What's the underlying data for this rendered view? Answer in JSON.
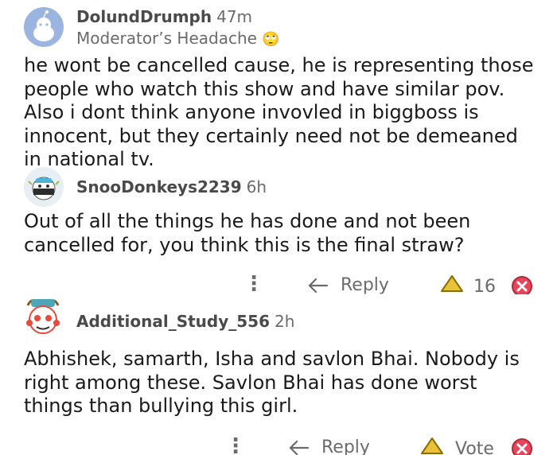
{
  "comments": [
    {
      "username": "DolundDrumph",
      "time": "47m",
      "flair": "Moderator’s Headache",
      "flair_emoji": "🙄",
      "body": "he wont be cancelled cause, he is representing those people who watch this show and have similar pov. Also i dont think anyone invovled in biggboss is innocent, but they certainly need not be demeaned in national tv."
    },
    {
      "username": "SnooDonkeys2239",
      "time": "6h",
      "body": "Out of all the things he has done and not been cancelled for, you think this is the final straw?",
      "actions": {
        "more_icon": "⋮",
        "reply": "Reply",
        "score": "16"
      }
    },
    {
      "username": "Additional_Study_556",
      "time": "2h",
      "body": "Abhishek, samarth, Isha and savlon Bhai. Nobody is right among these. Savlon Bhai has done worst things than bullying this girl.",
      "actions": {
        "more_icon": "⋮",
        "reply": "Reply",
        "vote": "Vote"
      }
    }
  ],
  "colors": {
    "upvote": "#e8c33a",
    "downvote": "#e8455a",
    "avatar_blue": "#8aa8d8"
  }
}
